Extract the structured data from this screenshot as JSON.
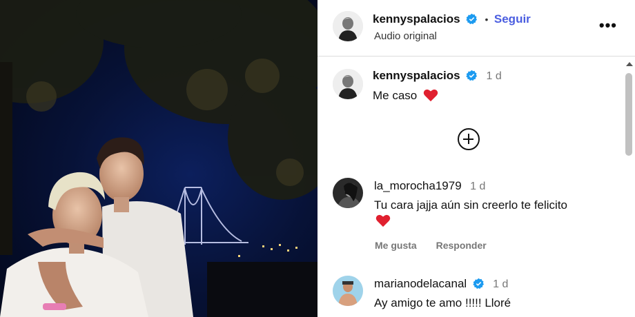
{
  "post": {
    "author": "kennyspalacios",
    "follow_label": "Seguir",
    "separator": "•",
    "audio_label": "Audio original",
    "more_label": "•••"
  },
  "comments": [
    {
      "user": "kennyspalacios",
      "verified": true,
      "time": "1 d",
      "text": "Me caso",
      "heart": true
    },
    {
      "user": "la_morocha1979",
      "verified": false,
      "time": "1 d",
      "text": "Tu cara jajja aún sin creerlo te felicito",
      "heart": true,
      "actions": {
        "like": "Me gusta",
        "reply": "Responder"
      }
    },
    {
      "user": "marianodelacanal",
      "verified": true,
      "time": "1 d",
      "text": "Ay amigo te amo !!!!! Lloré",
      "heart": false
    }
  ],
  "icons": {
    "verified": "verified-badge-icon",
    "heart": "red-heart-emoji",
    "load_more": "circle-plus-icon",
    "more": "more-options-icon"
  },
  "colors": {
    "follow": "#4a5de0",
    "verified": "#1d9bf0",
    "heart": "#e0202f"
  }
}
